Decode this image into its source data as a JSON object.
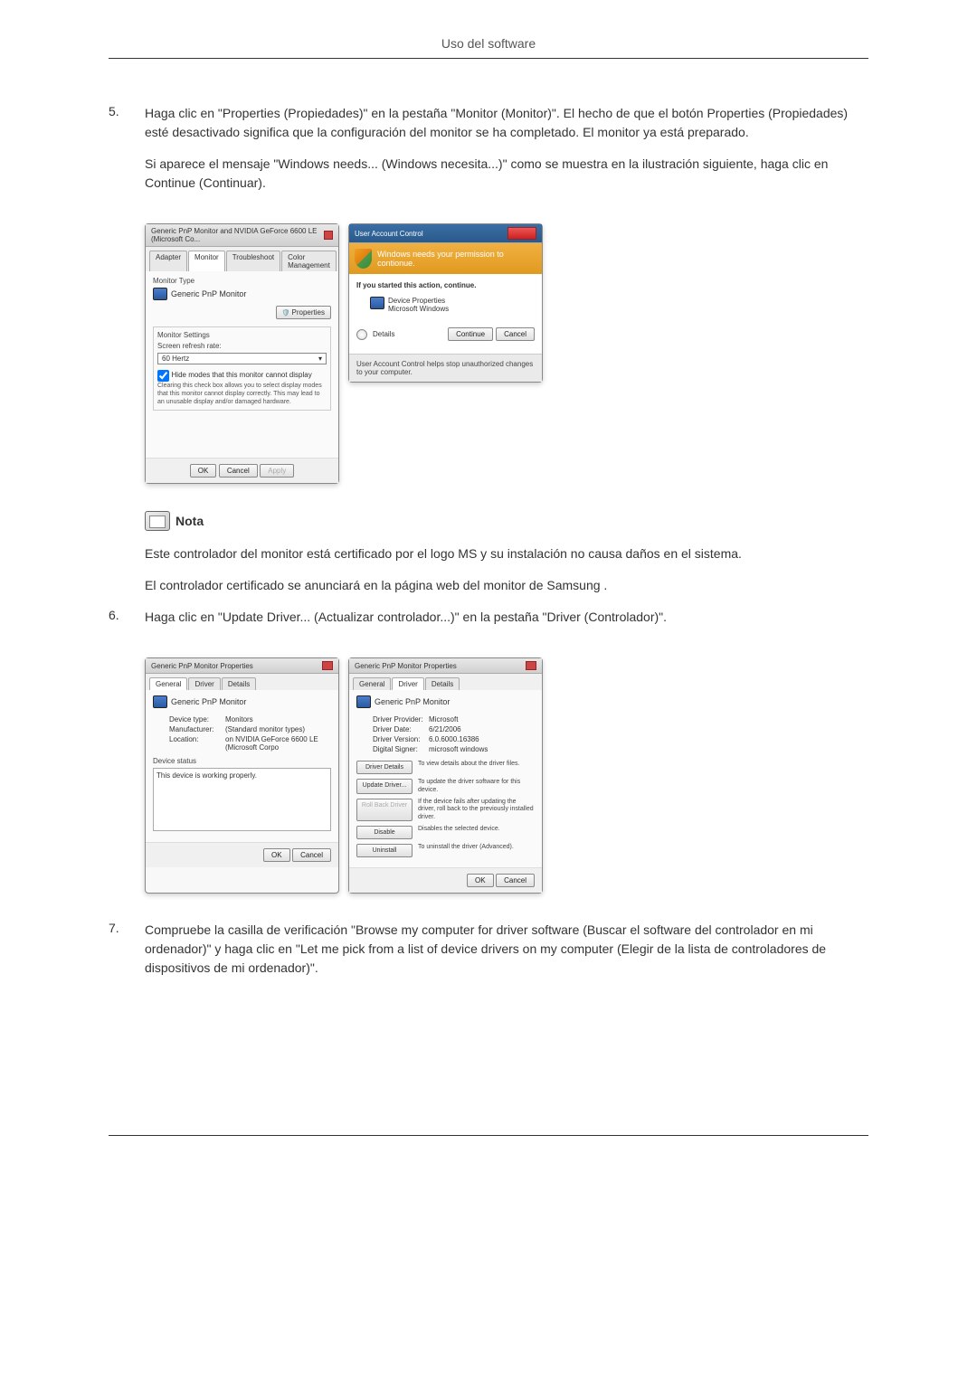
{
  "header": {
    "title": "Uso del software"
  },
  "step5": {
    "num": "5.",
    "para1": "Haga clic en \"Properties (Propiedades)\" en la pestaña \"Monitor (Monitor)\". El hecho de que el botón Properties (Propiedades) esté desactivado significa que la configuración del monitor se ha completado. El monitor ya está preparado.",
    "para2": "Si aparece el mensaje \"Windows needs... (Windows necesita...)\" como se muestra en la ilustración siguiente, haga clic en Continue (Continuar)."
  },
  "windowA": {
    "title": "Generic PnP Monitor and NVIDIA GeForce 6600 LE (Microsoft Co...",
    "tabs": [
      "Adapter",
      "Monitor",
      "Troubleshoot",
      "Color Management"
    ],
    "monitorTypeLabel": "Monitor Type",
    "monitorName": "Generic PnP Monitor",
    "propertiesBtn": "Properties",
    "settingsLabel": "Monitor Settings",
    "refreshLabel": "Screen refresh rate:",
    "refreshValue": "60 Hertz",
    "hideModesLabel": "Hide modes that this monitor cannot display",
    "hideModesDesc": "Clearing this check box allows you to select display modes that this monitor cannot display correctly. This may lead to an unusable display and/or damaged hardware.",
    "okBtn": "OK",
    "cancelBtn": "Cancel",
    "applyBtn": "Apply"
  },
  "windowB": {
    "title": "User Account Control",
    "banner": "Windows needs your permission to contionue.",
    "ifStarted": "If you started this action, continue.",
    "devProps": "Device Properties",
    "msWindows": "Microsoft Windows",
    "detailsBtn": "Details",
    "continueBtn": "Continue",
    "cancelBtn": "Cancel",
    "footer": "User Account Control helps stop unauthorized changes to your computer."
  },
  "note": {
    "heading": "Nota",
    "para1": "Este controlador del monitor está certificado por el logo MS y su instalación no causa daños en el sistema.",
    "para2": "El controlador certificado se anunciará en la página web del monitor de Samsung ."
  },
  "step6": {
    "num": "6.",
    "text": "Haga clic en \"Update Driver... (Actualizar controlador...)\" en la pestaña \"Driver (Controlador)\"."
  },
  "windowC": {
    "title": "Generic PnP Monitor Properties",
    "tabs": [
      "General",
      "Driver",
      "Details"
    ],
    "monitorName": "Generic PnP Monitor",
    "deviceTypeLabel": "Device type:",
    "deviceTypeValue": "Monitors",
    "manufacturerLabel": "Manufacturer:",
    "manufacturerValue": "(Standard monitor types)",
    "locationLabel": "Location:",
    "locationValue": "on NVIDIA GeForce 6600 LE (Microsoft Corpo",
    "statusLabel": "Device status",
    "statusText": "This device is working properly.",
    "okBtn": "OK",
    "cancelBtn": "Cancel"
  },
  "windowD": {
    "title": "Generic PnP Monitor Properties",
    "tabs": [
      "General",
      "Driver",
      "Details"
    ],
    "monitorName": "Generic PnP Monitor",
    "providerLabel": "Driver Provider:",
    "providerValue": "Microsoft",
    "dateLabel": "Driver Date:",
    "dateValue": "6/21/2006",
    "versionLabel": "Driver Version:",
    "versionValue": "6.0.6000.16386",
    "signerLabel": "Digital Signer:",
    "signerValue": "microsoft windows",
    "detailsBtn": "Driver Details",
    "detailsDesc": "To view details about the driver files.",
    "updateBtn": "Update Driver...",
    "updateDesc": "To update the driver software for this device.",
    "rollbackBtn": "Roll Back Driver",
    "rollbackDesc": "If the device fails after updating the driver, roll back to the previously installed driver.",
    "disableBtn": "Disable",
    "disableDesc": "Disables the selected device.",
    "uninstallBtn": "Uninstall",
    "uninstallDesc": "To uninstall the driver (Advanced).",
    "okBtn": "OK",
    "cancelBtn": "Cancel"
  },
  "step7": {
    "num": "7.",
    "text": "Compruebe la casilla de verificación \"Browse my computer for driver software (Buscar el software del controlador en mi ordenador)\" y haga clic en \"Let me pick from a list of device drivers on my computer (Elegir de la lista de controladores de dispositivos de mi ordenador)\"."
  }
}
